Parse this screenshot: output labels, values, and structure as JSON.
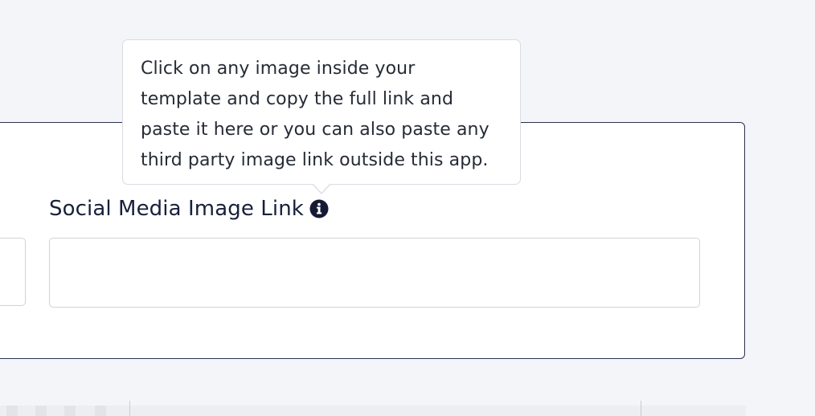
{
  "tooltip": {
    "lines": [
      "Click on any image inside your",
      "template and copy the full link and",
      "paste it here or you can also paste any",
      "third party image link outside this app."
    ]
  },
  "field": {
    "label": "Social Media Image Link",
    "value": "",
    "placeholder": "",
    "info_icon": "info-circle-icon"
  },
  "colors": {
    "page_background": "#f4f5f8",
    "card_border": "#2a3150",
    "label_text": "#18203a",
    "icon": "#141a33",
    "input_border": "#cfd3da",
    "tooltip_border": "#d9dce2"
  }
}
